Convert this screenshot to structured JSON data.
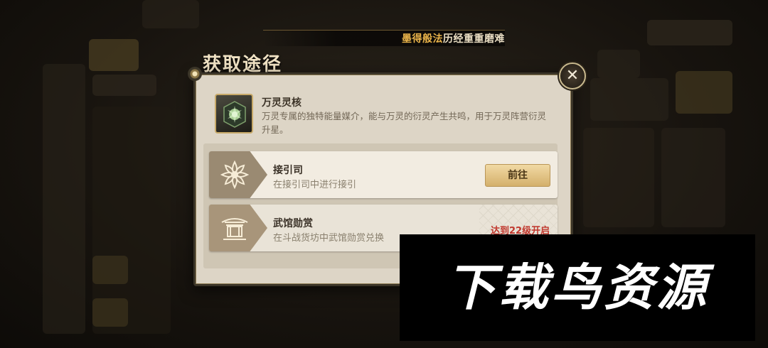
{
  "top_banner": {
    "highlight": "墨得般法",
    "text": "历经重重磨难"
  },
  "dialog": {
    "heading": "获取途径",
    "close_icon": "close-icon",
    "item": {
      "name": "万灵灵核",
      "description": "万灵专属的独特能量媒介，能与万灵的衍灵产生共鸣，用于万灵阵营衍灵升星。",
      "icon": "spirit-core-icon"
    },
    "sources": [
      {
        "title": "接引司",
        "subtitle": "在接引司中进行接引",
        "action_label": "前往",
        "icon": "lotus-emblem-icon"
      },
      {
        "title": "武馆勋赏",
        "subtitle": "在斗战货坊中武馆勋赏兑换",
        "locked_label": "达到22级开启",
        "icon": "pavilion-icon"
      }
    ]
  },
  "watermark": {
    "text": "下载鸟资源"
  },
  "colors": {
    "accent_gold": "#d4b06b",
    "lock_red": "#c0362c",
    "panel_bg": "#ddd5c6"
  }
}
